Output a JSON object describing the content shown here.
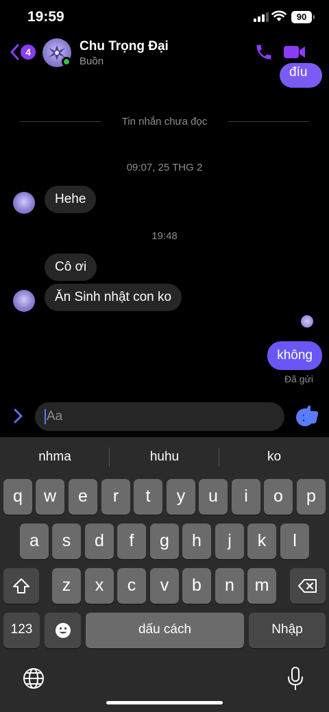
{
  "status_bar": {
    "time": "19:59",
    "battery": "90"
  },
  "header": {
    "back_count": "4",
    "contact_name": "Chu Trọng Đại",
    "contact_status": "Buồn"
  },
  "chat": {
    "partial_bubble_text": "đíu",
    "unread_divider": "Tin nhắn chưa đọc",
    "timestamp_1": "09:07, 25 THG 2",
    "msg_hehe": "Hehe",
    "timestamp_2": "19:48",
    "msg_co_oi": "Cô ơi",
    "msg_sinh_nhat": "Ăn Sinh nhật con ko",
    "msg_khong": "không",
    "sent_status": "Đã gửi"
  },
  "composer": {
    "placeholder": "Aa"
  },
  "keyboard": {
    "suggestions": [
      "nhma",
      "huhu",
      "ko"
    ],
    "row1": [
      "q",
      "w",
      "e",
      "r",
      "t",
      "y",
      "u",
      "i",
      "o",
      "p"
    ],
    "row2": [
      "a",
      "s",
      "d",
      "f",
      "g",
      "h",
      "j",
      "k",
      "l"
    ],
    "row3": [
      "z",
      "x",
      "c",
      "v",
      "b",
      "n",
      "m"
    ],
    "numbers_key": "123",
    "space_key": "dấu cách",
    "return_key": "Nhập"
  },
  "colors": {
    "accent": "#8b3cf6",
    "outgoing_bubble": "#6a56f5",
    "incoming_bubble": "#262626",
    "online": "#31c24d"
  },
  "icons": [
    "back-chevron-icon",
    "phone-icon",
    "video-camera-icon",
    "expand-chevron-icon",
    "emoji-icon",
    "thumbs-up-icon",
    "shift-icon",
    "backspace-icon",
    "keyboard-emoji-icon",
    "globe-icon",
    "microphone-icon"
  ]
}
